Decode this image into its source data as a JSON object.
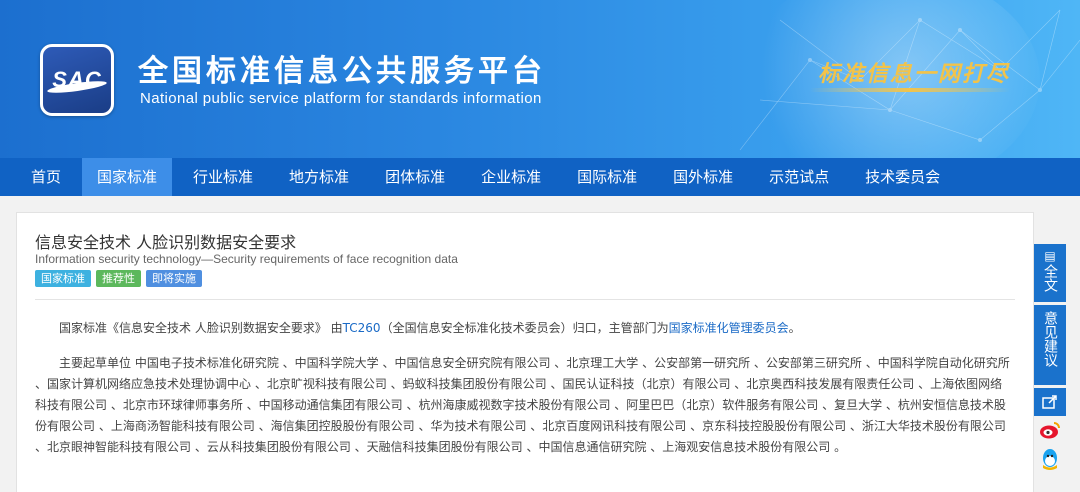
{
  "header": {
    "logo_text": "SAC",
    "title_cn": "全国标准信息公共服务平台",
    "title_en": "National public service platform  for standards information",
    "slogan": "标准信息一网打尽"
  },
  "nav": {
    "items": [
      {
        "label": "首页"
      },
      {
        "label": "国家标准"
      },
      {
        "label": "行业标准"
      },
      {
        "label": "地方标准"
      },
      {
        "label": "团体标准"
      },
      {
        "label": "企业标准"
      },
      {
        "label": "国际标准"
      },
      {
        "label": "国外标准"
      },
      {
        "label": "示范试点"
      },
      {
        "label": "技术委员会"
      }
    ],
    "active_index": 1
  },
  "standard": {
    "title_cn": "信息安全技术 人脸识别数据安全要求",
    "title_en": "Information security technology—Security requirements of face recognition data",
    "tags": [
      "国家标准",
      "推荐性",
      "即将实施"
    ],
    "para1_prefix": "国家标准《信息安全技术 人脸识别数据安全要求》 由",
    "para1_tc": "TC260",
    "para1_mid": "（全国信息安全标准化技术委员会）归口，主管部门为",
    "para1_dept": "国家标准化管理委员会",
    "para1_suffix": "。",
    "para2": "主要起草单位 中国电子技术标准化研究院 、中国科学院大学 、中国信息安全研究院有限公司 、北京理工大学 、公安部第一研究所 、公安部第三研究所 、中国科学院自动化研究所 、国家计算机网络应急技术处理协调中心 、北京旷视科技有限公司 、蚂蚁科技集团股份有限公司 、国民认证科技（北京）有限公司 、北京奥西科技发展有限责任公司 、上海依图网络科技有限公司 、北京市环球律师事务所 、中国移动通信集团有限公司 、杭州海康威视数字技术股份有限公司 、阿里巴巴（北京）软件服务有限公司 、复旦大学 、杭州安恒信息技术股份有限公司 、上海商汤智能科技有限公司 、海信集团控股股份有限公司 、华为技术有限公司 、北京百度网讯科技有限公司 、京东科技控股股份有限公司 、浙江大华技术股份有限公司 、北京眼神智能科技有限公司 、云从科技集团股份有限公司 、天融信科技集团股份有限公司 、中国信息通信研究院 、上海观安信息技术股份有限公司 。"
  },
  "sidebar": {
    "fulltext": "全文",
    "feedback": "意见建议"
  },
  "colors": {
    "nav_bg": "#1062c4",
    "nav_active": "#3d8ee8",
    "link": "#1a6ac6",
    "sidebar_bg": "#1a72cc"
  }
}
